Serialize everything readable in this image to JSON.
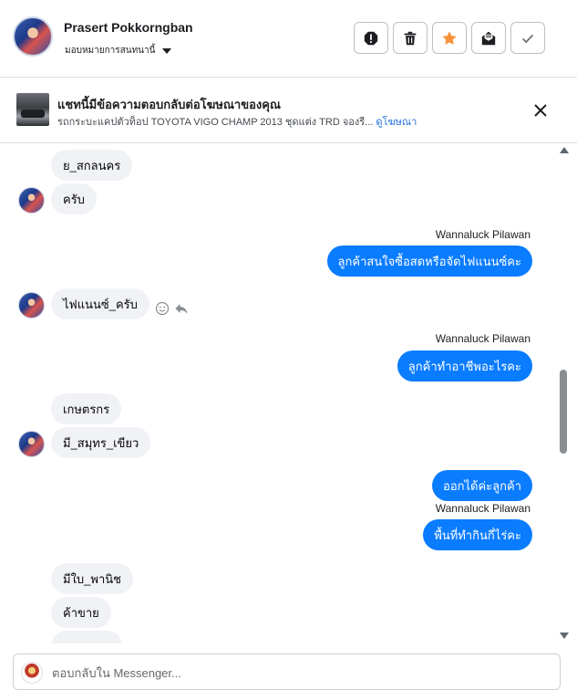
{
  "header": {
    "contact_name": "Prasert Pokkorngban",
    "assign_label": "มอบหมายการสนทนานี้",
    "buttons": {
      "report": "report-icon",
      "delete": "trash-icon",
      "star": "star-icon",
      "mark_unread": "mail-icon",
      "done": "check-icon"
    }
  },
  "ad_banner": {
    "title": "แชทนี้มีข้อความตอบกลับต่อโฆษณาของคุณ",
    "subtitle": "รถกระบะแคปตัวท็อป TOYOTA VIGO CHAMP 2013 ชุดแต่ง TRD จองรี... ",
    "link": "ดูโฆษณา"
  },
  "messages": [
    {
      "dir": "in",
      "text": "ย_สกลนคร"
    },
    {
      "dir": "in",
      "text": "ครับ"
    },
    {
      "dir": "out",
      "sender": "Wannaluck Pilawan",
      "text": "ลูกค้าสนใจซื้อสดหรือจัดไฟแนนซ์คะ"
    },
    {
      "dir": "in",
      "text": "ไฟแนนซ์_ครับ"
    },
    {
      "dir": "out",
      "sender": "Wannaluck Pilawan",
      "text": "ลูกค้าทำอาชีพอะไรคะ"
    },
    {
      "dir": "in",
      "text": "เกษตรกร"
    },
    {
      "dir": "in",
      "text": "มี_สมุทร_เขียว"
    },
    {
      "dir": "out",
      "text": "ออกได้ค่ะลูกค้า"
    },
    {
      "dir": "out",
      "sender": "Wannaluck Pilawan",
      "text": "พื้นที่ทำกินกี่ไร่คะ"
    },
    {
      "dir": "in",
      "text": "มีใบ_พานิช"
    },
    {
      "dir": "in",
      "text": "ค้าขาย"
    }
  ],
  "composer": {
    "placeholder": "ตอบกลับใน Messenger..."
  },
  "colors": {
    "outgoing_bubble": "#0a7cff",
    "incoming_bubble": "#f0f2f5",
    "star_accent": "#f7923a"
  }
}
